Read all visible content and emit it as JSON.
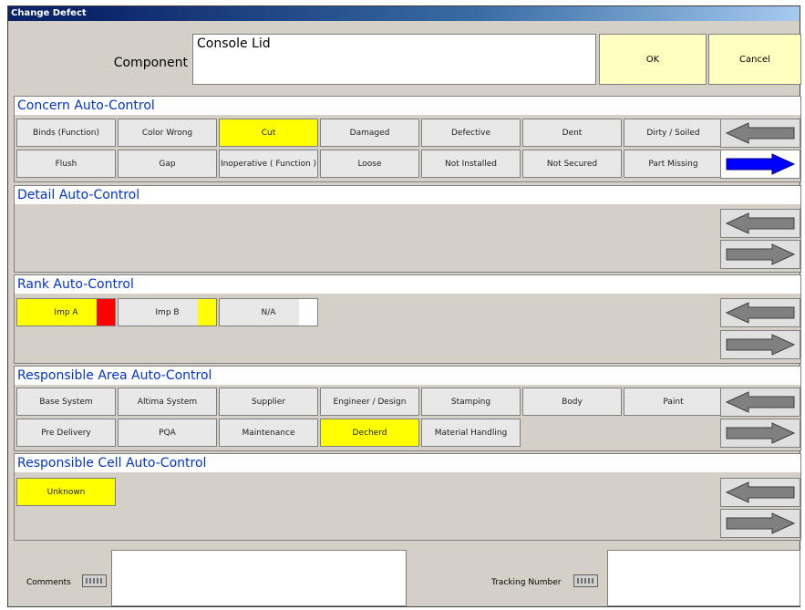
{
  "window": {
    "title": "Change Defect"
  },
  "component": {
    "label": "Component",
    "value": "Console Lid"
  },
  "top_buttons": {
    "ok": "OK",
    "cancel": "Cancel"
  },
  "concern": {
    "title": "Concern Auto-Control",
    "row1": [
      "Binds (Function)",
      "Color Wrong",
      "Cut",
      "Damaged",
      "Defective",
      "Dent",
      "Dirty / Soiled"
    ],
    "row2": [
      "Flush",
      "Gap",
      "Inoperative ( Function )",
      "Loose",
      "Not Installed",
      "Not Secured",
      "Part Missing"
    ],
    "selected": "Cut"
  },
  "detail": {
    "title": "Detail Auto-Control"
  },
  "rank": {
    "title": "Rank Auto-Control",
    "items": [
      {
        "label": "Imp A",
        "color": "#ff0000",
        "selected": true
      },
      {
        "label": "Imp B",
        "color": "#ffff00",
        "selected": false
      },
      {
        "label": "N/A",
        "color": "#ffffff",
        "selected": false
      }
    ]
  },
  "resp_area": {
    "title": "Responsible Area Auto-Control",
    "row1": [
      "Base System",
      "Altima System",
      "Supplier",
      "Engineer / Design",
      "Stamping",
      "Body",
      "Paint"
    ],
    "row2": [
      "Pre Delivery",
      "PQA",
      "Maintenance",
      "Decherd",
      "Material Handling"
    ],
    "selected": "Decherd"
  },
  "resp_cell": {
    "title": "Responsible Cell Auto-Control",
    "items": [
      "Unknown"
    ],
    "selected": "Unknown"
  },
  "bottom": {
    "comments_label": "Comments",
    "tracking_label": "Tracking Number",
    "comments_value": "",
    "tracking_value": ""
  },
  "icons": {
    "back_arrow": "arrow-left-icon",
    "forward_arrow": "arrow-right-icon",
    "keyboard": "keyboard-icon"
  },
  "colors": {
    "selected": "#ffff00",
    "ok_bg": "#ffffc0",
    "title_text": "#0033cc",
    "arrow_active": "#0000ff",
    "arrow_inactive": "#808080"
  }
}
